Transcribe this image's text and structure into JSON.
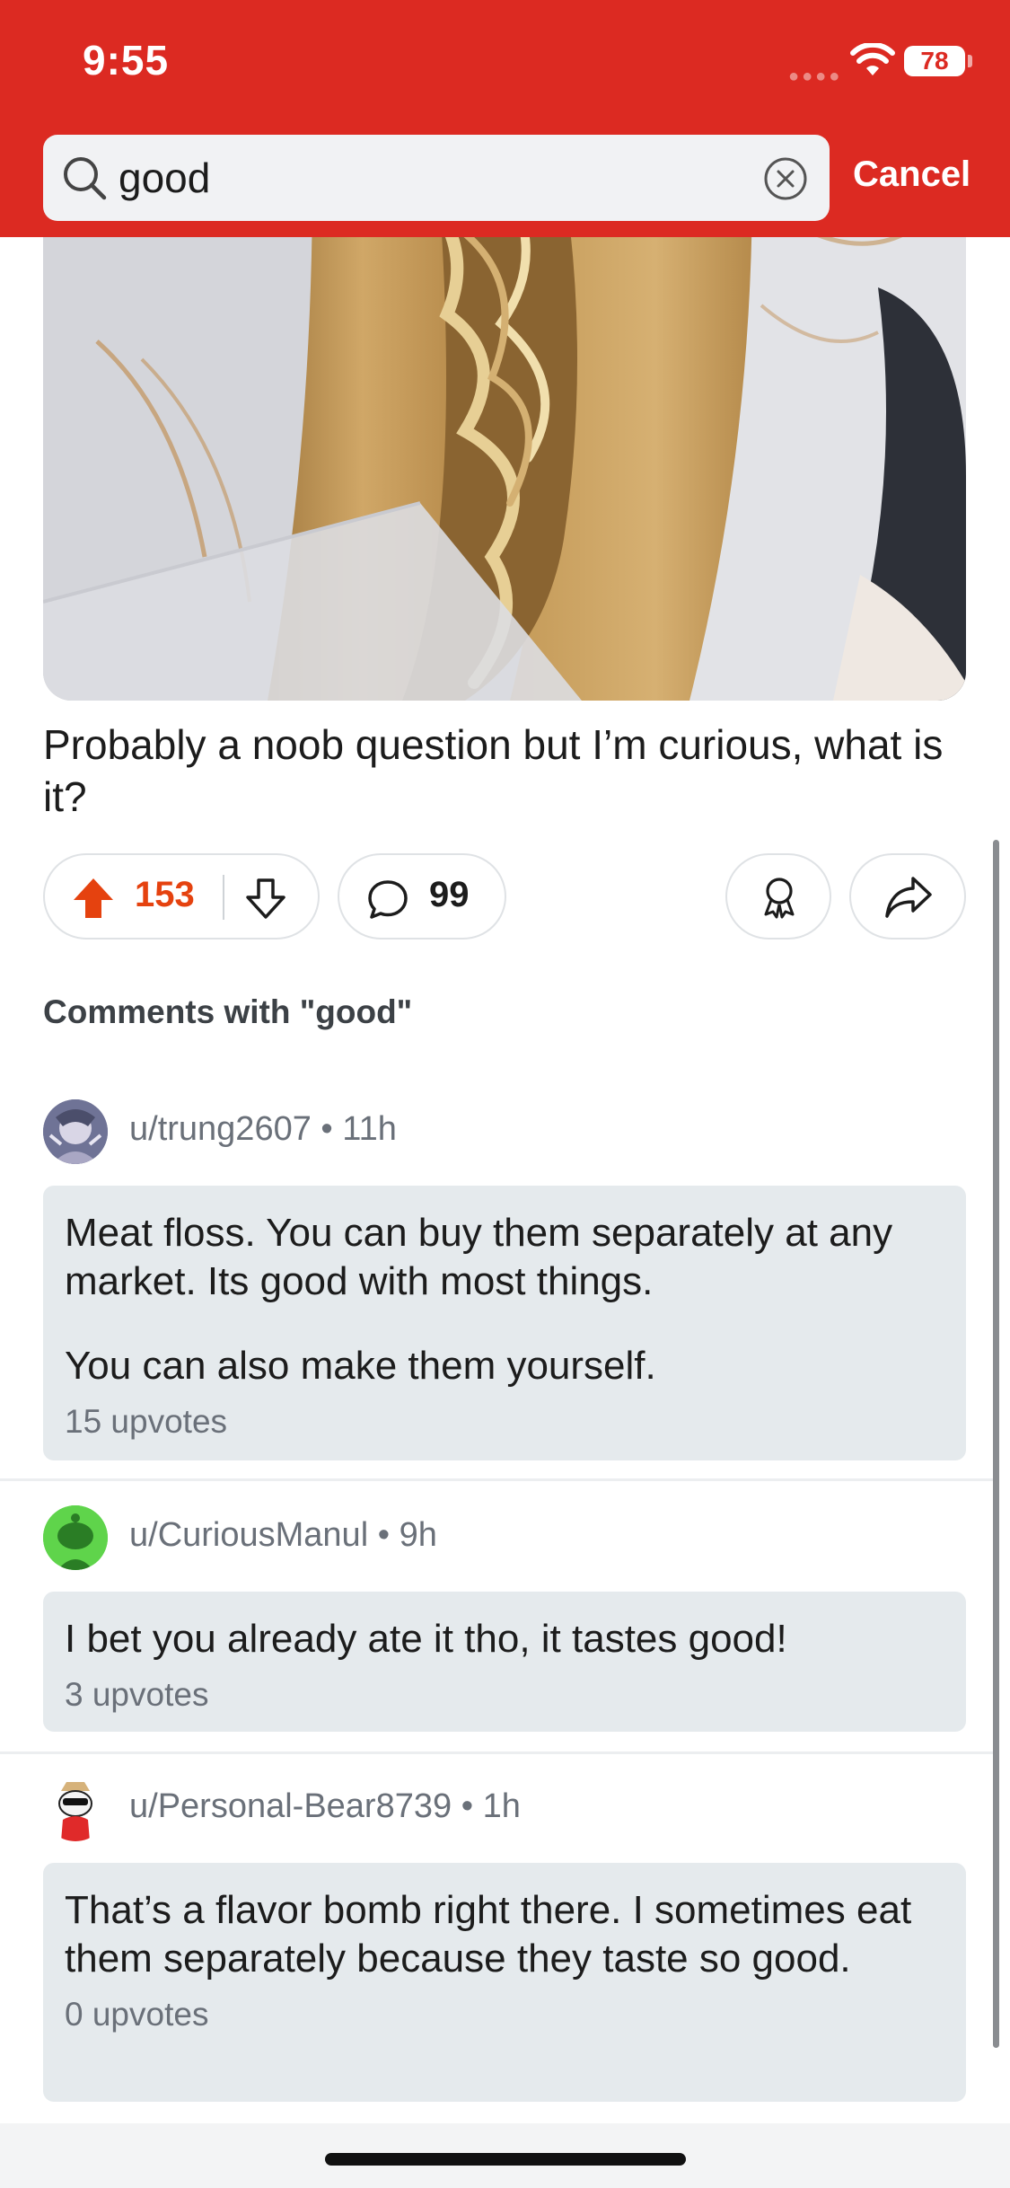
{
  "status_bar": {
    "time": "9:55",
    "battery": "78"
  },
  "search": {
    "value": "good",
    "cancel_label": "Cancel"
  },
  "post": {
    "title": "Probably a noob question but I’m curious, what is it?",
    "upvotes": "153",
    "comments": "99"
  },
  "comments_heading": "Comments with \"good\"",
  "comments": [
    {
      "author": "u/trung2607",
      "age": "11h",
      "paragraphs": [
        "Meat floss. You can buy them separately at any market. Its good with most things.",
        "You can also make them yourself."
      ],
      "upvotes": "15 upvotes"
    },
    {
      "author": "u/CuriousManul",
      "age": "9h",
      "paragraphs": [
        "I bet you already ate it tho, it tastes good!"
      ],
      "upvotes": "3 upvotes"
    },
    {
      "author": "u/Personal-Bear8739",
      "age": "1h",
      "paragraphs": [
        "That’s a flavor bomb right there. I sometimes eat them separately because they taste so good."
      ],
      "upvotes": "0 upvotes"
    }
  ],
  "colors": {
    "header": "#dc2a22",
    "upvote": "#e5420f",
    "bubble": "#e5eaed"
  }
}
